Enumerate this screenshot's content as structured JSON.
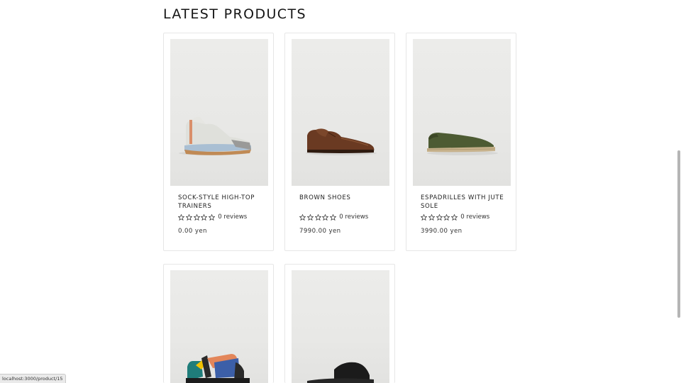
{
  "section": {
    "title": "LATEST PRODUCTS"
  },
  "products": [
    {
      "name": "SOCK-STYLE HIGH-TOP TRAINERS",
      "rating": 0,
      "reviews": "0 reviews",
      "price": "0.00 yen",
      "image_icon": "trainer-shoe-image"
    },
    {
      "name": "BROWN SHOES",
      "rating": 0,
      "reviews": "0 reviews",
      "price": "7990.00 yen",
      "image_icon": "brown-shoe-image"
    },
    {
      "name": "ESPADRILLES WITH JUTE SOLE",
      "rating": 0,
      "reviews": "0 reviews",
      "price": "3990.00 yen",
      "image_icon": "espadrille-image"
    },
    {
      "name": "",
      "rating": 0,
      "reviews": "",
      "price": "",
      "image_icon": "sandal-image"
    },
    {
      "name": "",
      "rating": 0,
      "reviews": "",
      "price": "",
      "image_icon": "slide-sandal-image"
    }
  ],
  "status_bar": {
    "url": "localhost:3000/product/15"
  },
  "colors": {
    "card_border": "#e6e6e6",
    "image_background": "#e9e9e7",
    "text": "#222222"
  }
}
